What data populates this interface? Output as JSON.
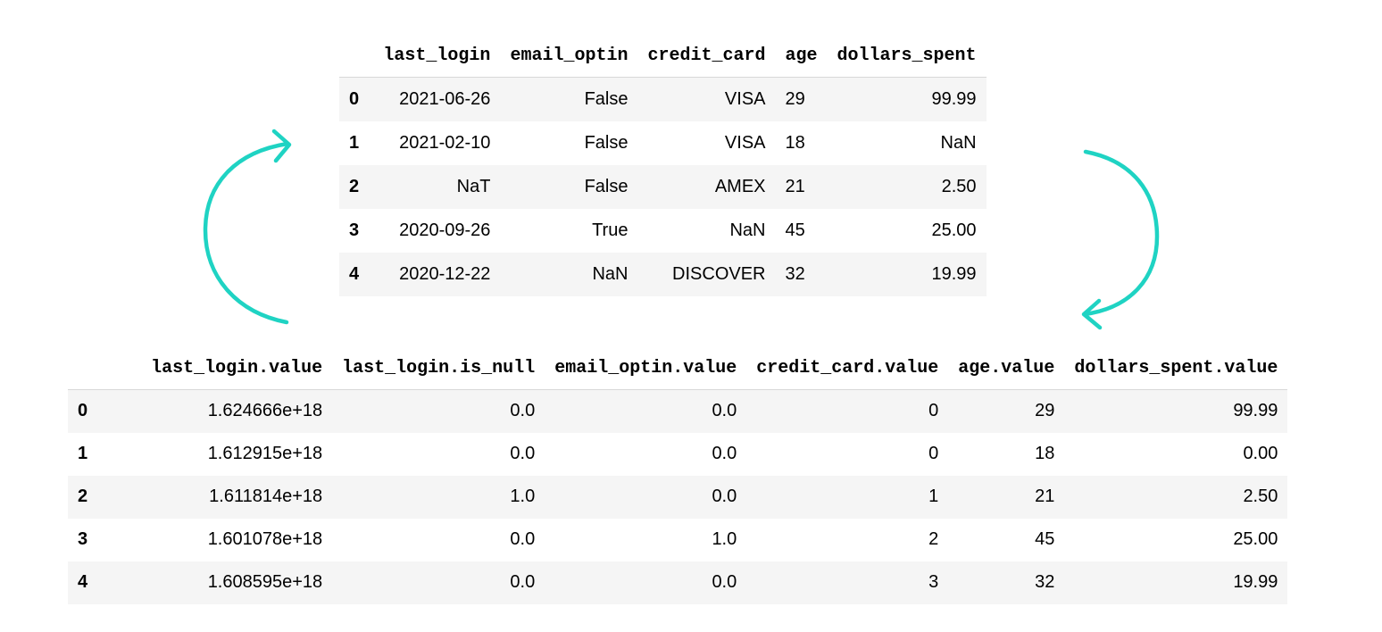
{
  "top_table": {
    "columns": [
      "",
      "last_login",
      "email_optin",
      "credit_card",
      "age",
      "dollars_spent"
    ],
    "rows": [
      [
        "0",
        "2021-06-26",
        "False",
        "VISA",
        "29",
        "99.99"
      ],
      [
        "1",
        "2021-02-10",
        "False",
        "VISA",
        "18",
        "NaN"
      ],
      [
        "2",
        "NaT",
        "False",
        "AMEX",
        "21",
        "2.50"
      ],
      [
        "3",
        "2020-09-26",
        "True",
        "NaN",
        "45",
        "25.00"
      ],
      [
        "4",
        "2020-12-22",
        "NaN",
        "DISCOVER",
        "32",
        "19.99"
      ]
    ]
  },
  "bottom_table": {
    "columns": [
      "",
      "last_login.value",
      "last_login.is_null",
      "email_optin.value",
      "credit_card.value",
      "age.value",
      "dollars_spent.value"
    ],
    "rows": [
      [
        "0",
        "1.624666e+18",
        "0.0",
        "0.0",
        "0",
        "29",
        "99.99"
      ],
      [
        "1",
        "1.612915e+18",
        "0.0",
        "0.0",
        "0",
        "18",
        "0.00"
      ],
      [
        "2",
        "1.611814e+18",
        "1.0",
        "0.0",
        "1",
        "21",
        "2.50"
      ],
      [
        "3",
        "1.601078e+18",
        "0.0",
        "1.0",
        "2",
        "45",
        "25.00"
      ],
      [
        "4",
        "1.608595e+18",
        "0.0",
        "0.0",
        "3",
        "32",
        "19.99"
      ]
    ]
  },
  "colors": {
    "arrow": "#1fd3c3",
    "row_stripe": "#f5f5f5",
    "header_rule": "#d8d8d8"
  },
  "icons": [
    "curved-arrow-left-icon",
    "curved-arrow-right-icon"
  ]
}
